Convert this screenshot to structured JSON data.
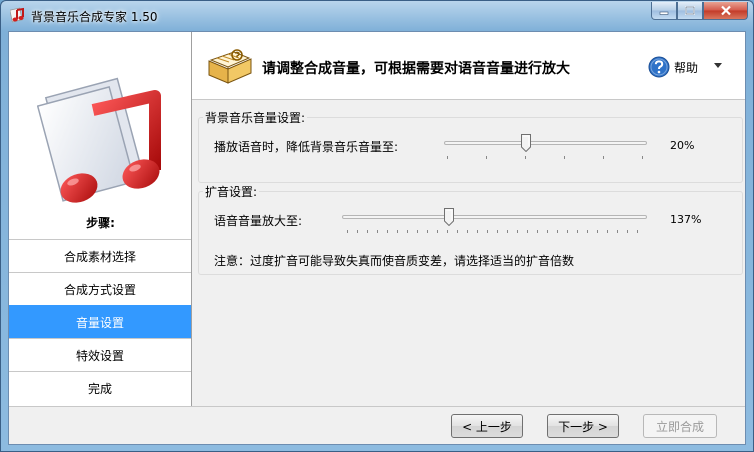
{
  "window": {
    "title": "背景音乐合成专家 1.50"
  },
  "sidebar": {
    "steps_title": "步骤:",
    "steps": [
      {
        "label": "合成素材选择",
        "active": false
      },
      {
        "label": "合成方式设置",
        "active": false
      },
      {
        "label": "音量设置",
        "active": true
      },
      {
        "label": "特效设置",
        "active": false
      },
      {
        "label": "完成",
        "active": false
      }
    ]
  },
  "header": {
    "instruction": "请调整合成音量，可根据需要对语音音量进行放大",
    "help_label": "帮助"
  },
  "bg_music": {
    "group_label": "背景音乐音量设置:",
    "slider_label": "播放语音时，降低背景音乐音量至:",
    "value_text": "20%",
    "value": 20
  },
  "amplify": {
    "group_label": "扩音设置:",
    "slider_label": "语音音量放大至:",
    "value_text": "137%",
    "value": 137,
    "note": "注意：过度扩音可能导致失真而使音质变差，请选择适当的扩音倍数"
  },
  "buttons": {
    "prev": "< 上一步",
    "next": "下一步 >",
    "compose": "立即合成"
  },
  "colors": {
    "active_step": "#3399ff"
  }
}
